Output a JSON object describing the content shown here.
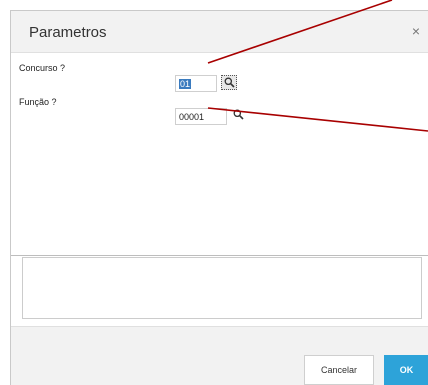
{
  "dialog": {
    "title": "Parametros",
    "close_icon": "×"
  },
  "fields": [
    {
      "label": "Concurso ?",
      "value": "01",
      "lookup_icon": "search-icon"
    },
    {
      "label": "Função ?",
      "value": "00001",
      "lookup_icon": "search-icon"
    }
  ],
  "memo": {
    "value": ""
  },
  "footer": {
    "cancel_label": "Cancelar",
    "ok_label": "OK"
  },
  "colors": {
    "annotation_arrow": "#a80000",
    "ok_button": "#2da3d9",
    "selection": "#3a7bbf"
  }
}
